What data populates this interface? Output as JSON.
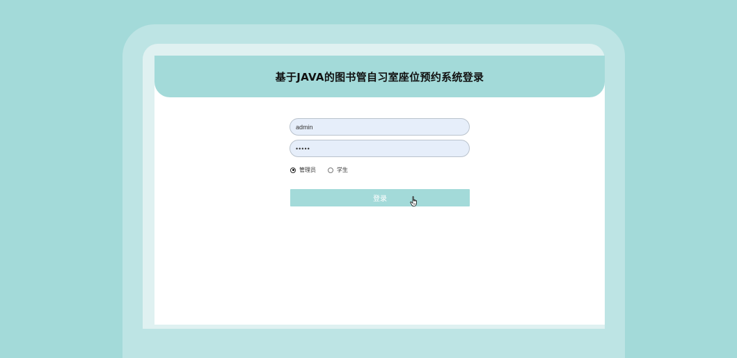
{
  "header": {
    "title": "基于JAVA的图书管自习室座位预约系统登录"
  },
  "form": {
    "username_value": "admin",
    "password_value": "•••••",
    "roles": [
      {
        "label": "管理员",
        "selected": true
      },
      {
        "label": "学生",
        "selected": false
      }
    ],
    "login_label": "登录"
  },
  "colors": {
    "background": "#a3dad9",
    "header_bg": "#a3dad9",
    "button_bg": "#a3dad9",
    "input_bg": "#e6eefa"
  },
  "icons": {
    "cursor": "hand-pointer-icon"
  }
}
